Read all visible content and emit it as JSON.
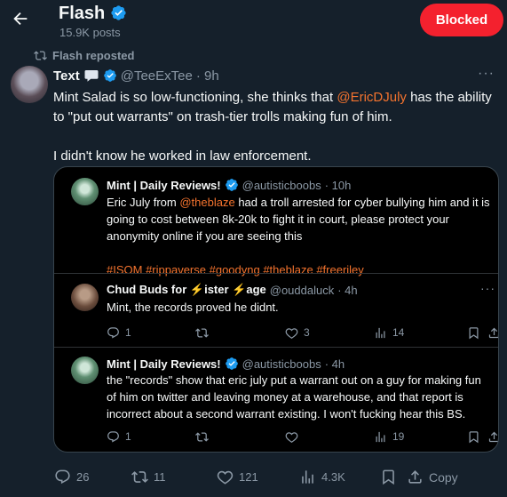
{
  "header": {
    "title": "Flash",
    "posts": "15.9K posts",
    "blocked_label": "Blocked"
  },
  "repost_label": "Flash reposted",
  "tweet": {
    "name": "Text",
    "handle": "@TeeExTee",
    "time": "· 9h",
    "text_before": "Mint Salad is so low-functioning, she thinks that ",
    "mention": "@EricDJuly",
    "text_after": " has the ability to \"put out warrants\" on trash-tier trolls making fun of him.",
    "text2": "I didn't know he worked in law enforcement."
  },
  "quote": {
    "name": "Mint | Daily Reviews!",
    "handle": "@autisticboobs",
    "time": "· 10h",
    "text_before": "Eric July from ",
    "mention": "@theblaze",
    "text_after": " had a troll arrested for cyber bullying him and it is going to cost between 8k-20k to fight it in court, please protect your anonymity online if you are seeing this",
    "hashtags": "#ISOM #rippaverse #goodyng #theblaze #freeriley"
  },
  "reply1": {
    "name_part1": "Chud Buds for ",
    "name_part2": "ister ",
    "name_part3": "age",
    "handle": "@ouddaluck",
    "time": "· 4h",
    "text": "Mint, the records proved he didnt.",
    "replies": "1",
    "likes": "3",
    "views": "14"
  },
  "reply2": {
    "name": "Mint | Daily Reviews!",
    "handle": "@autisticboobs",
    "time": "· 4h",
    "text": "the \"records\" show that eric july put a warrant out on a guy for making fun of him on twitter and leaving money at a warehouse, and that report is incorrect about a second warrant existing. I won't fucking hear this BS.",
    "replies": "1",
    "views": "19"
  },
  "stats": {
    "replies": "26",
    "reposts": "11",
    "likes": "121",
    "views": "4.3K",
    "copy_label": "Copy"
  },
  "more_label": "···",
  "colors": {
    "background": "#15202b",
    "accent_link": "#f4732e",
    "verified": "#1d9bf0",
    "blocked": "#f4212e",
    "muted": "#8b98a5"
  }
}
